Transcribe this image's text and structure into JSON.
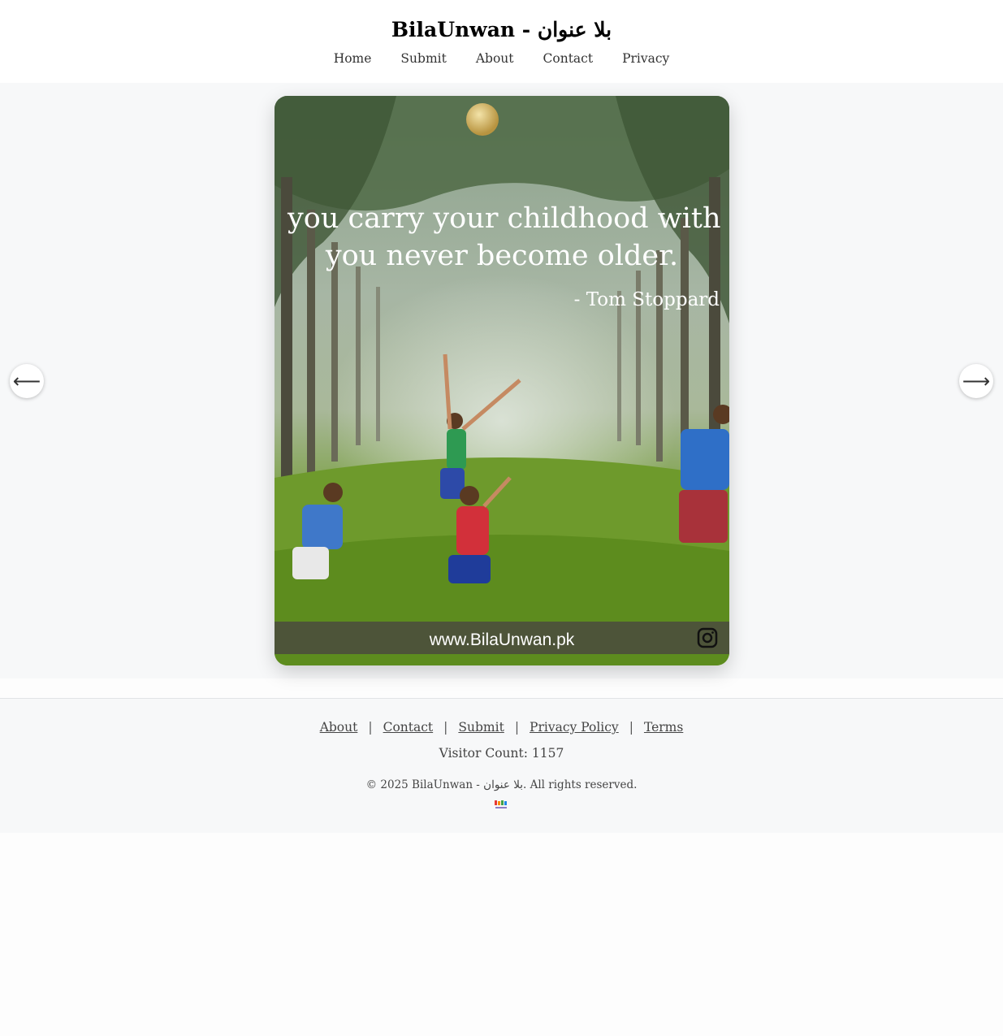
{
  "header": {
    "title": "BilaUnwan - بلا عنوان",
    "nav": [
      "Home",
      "Submit",
      "About",
      "Contact",
      "Privacy"
    ]
  },
  "slide": {
    "quote_line1": "you carry your childhood with you",
    "quote_line2": "you never become older.",
    "attribution": "- Tom Stoppard",
    "watermark": "www.BilaUnwan.pk"
  },
  "controls": {
    "prev_glyph": "⟵",
    "next_glyph": "⟶"
  },
  "footer": {
    "links": [
      "About",
      "Contact",
      "Submit",
      "Privacy Policy",
      "Terms"
    ],
    "separator": "|",
    "visitor_count": "Visitor Count: 1157",
    "copyright": "© 2025 BilaUnwan - بلا عنوان. All rights reserved."
  },
  "colors": {
    "header_bg": "#ffffff",
    "section_bg": "#f7f8f9",
    "text": "#333333"
  }
}
